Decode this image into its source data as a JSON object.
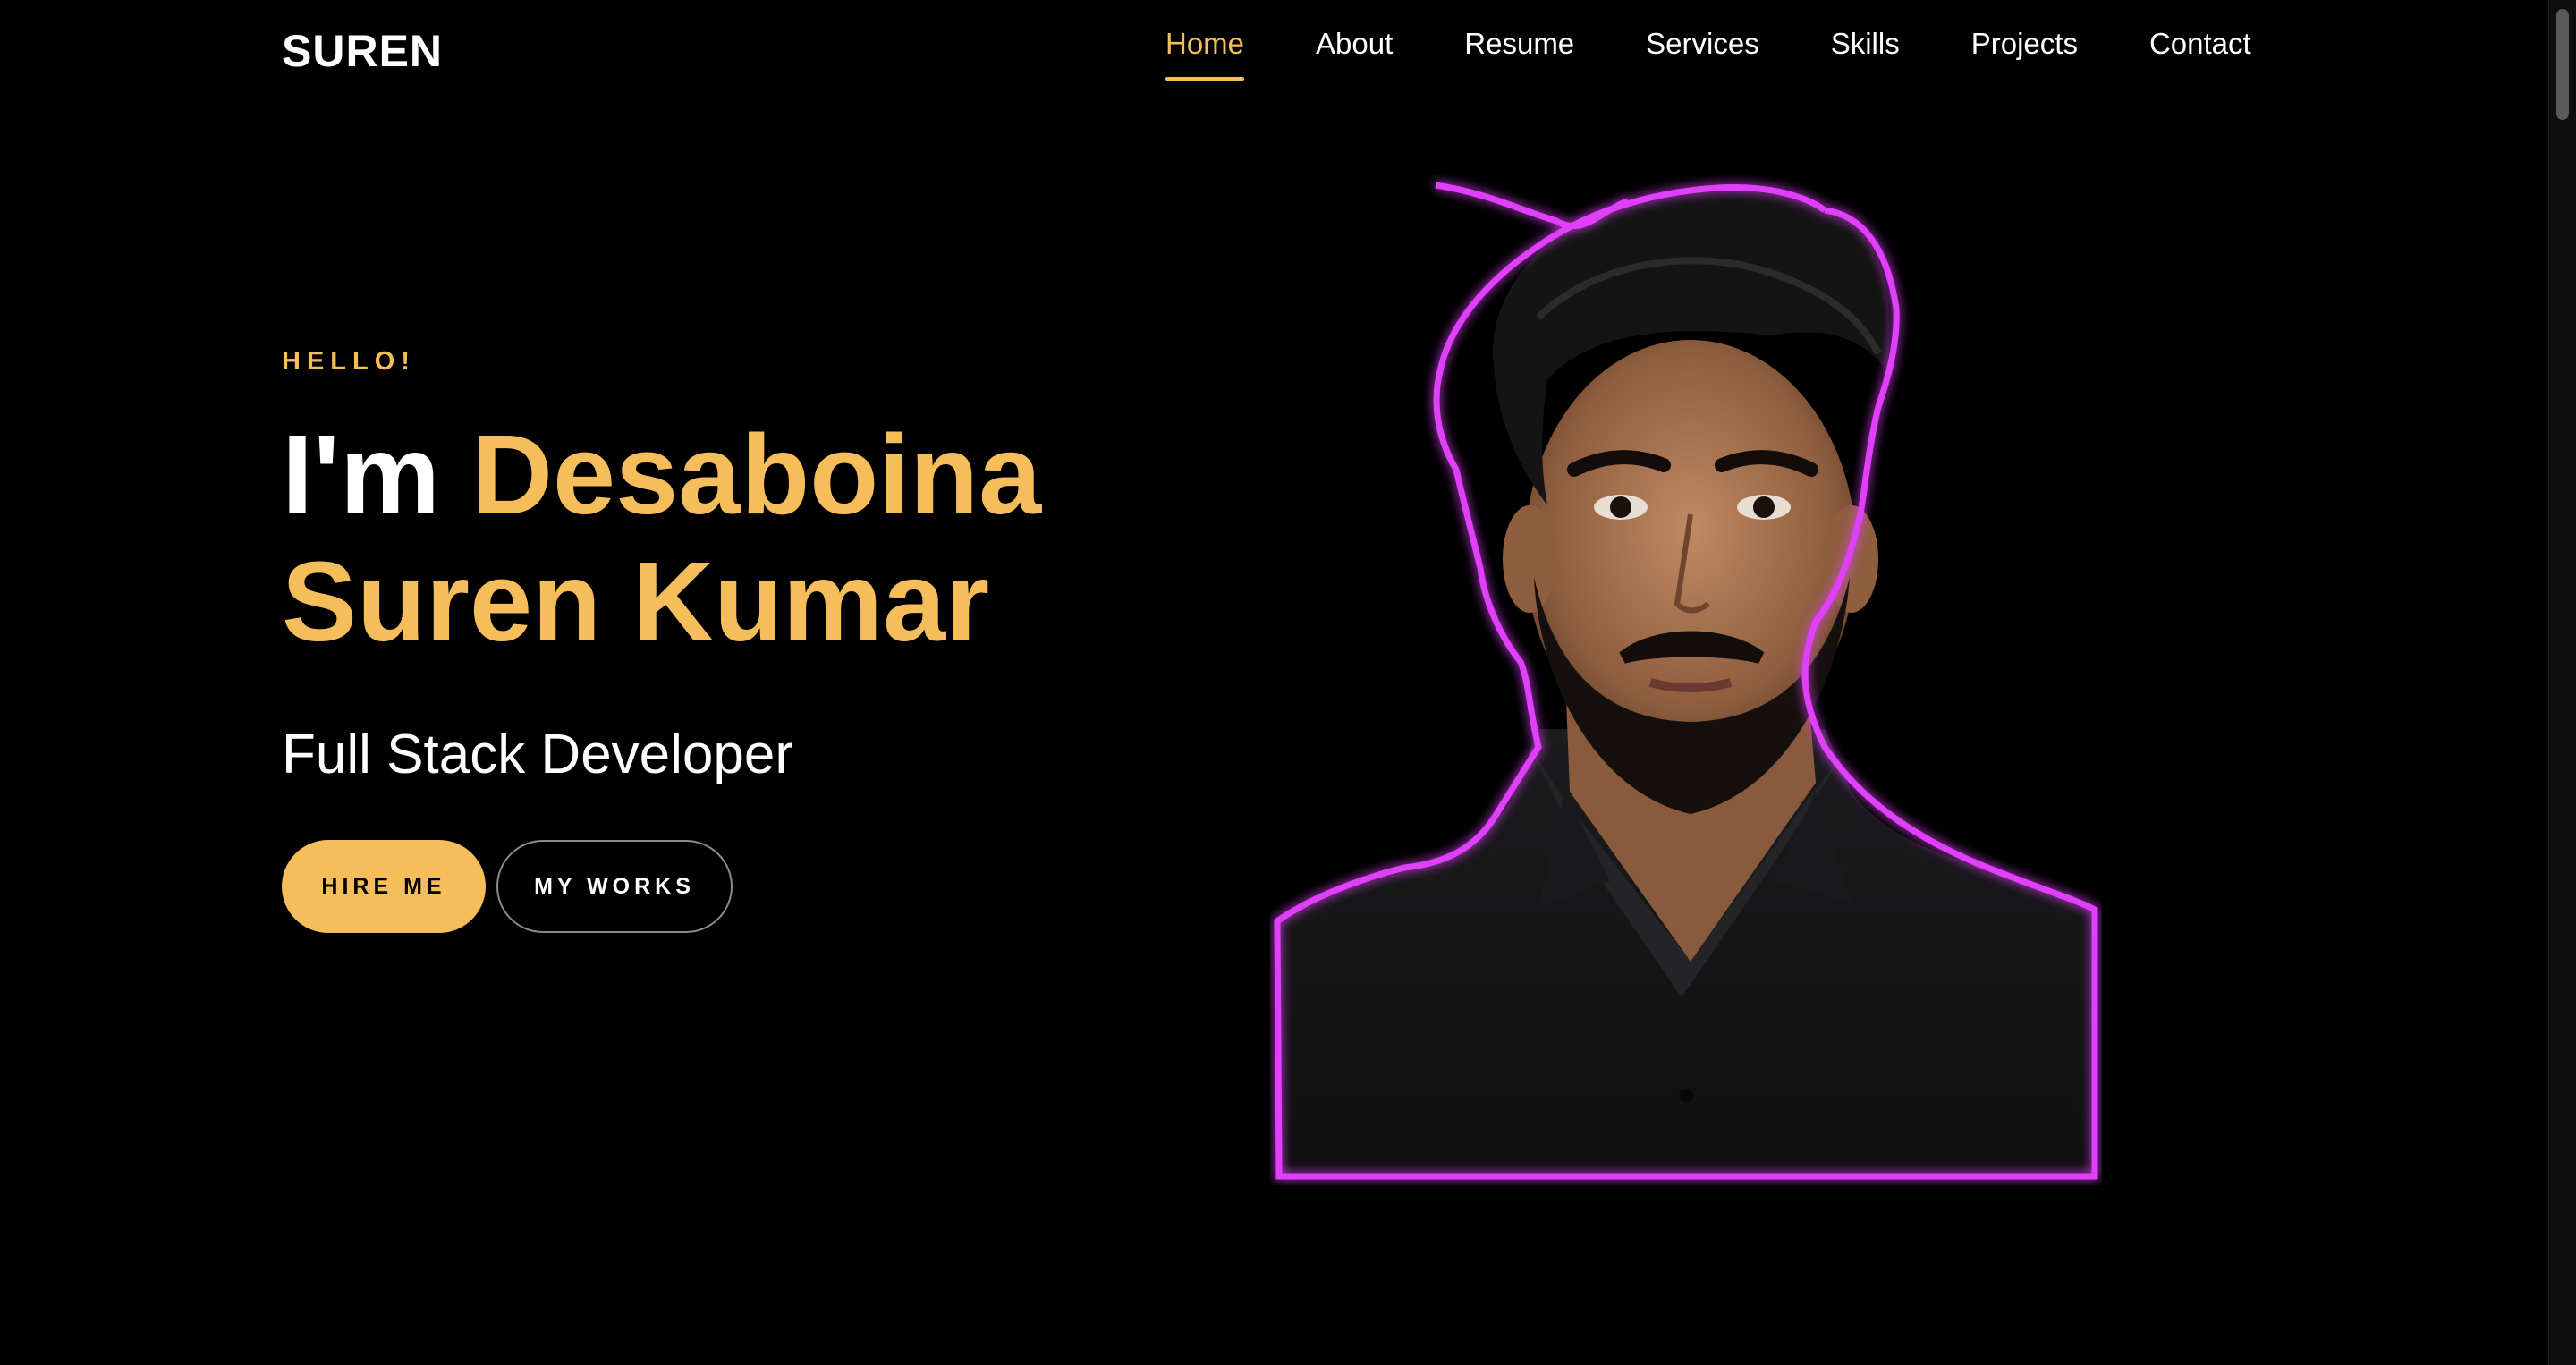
{
  "brand": {
    "name": "SUREN"
  },
  "nav": {
    "items": [
      {
        "label": "Home",
        "active": true
      },
      {
        "label": "About"
      },
      {
        "label": "Resume"
      },
      {
        "label": "Services"
      },
      {
        "label": "Skills"
      },
      {
        "label": "Projects"
      },
      {
        "label": "Contact"
      }
    ]
  },
  "hero": {
    "greeting": "HELLO!",
    "intro": "I'm ",
    "name_line1": "Desaboina",
    "name_line2": "Suren Kumar",
    "role": "Full Stack Developer",
    "hire_button": "HIRE ME",
    "works_button": "MY WORKS"
  },
  "colors": {
    "accent": "#f6bd5b",
    "background": "#000000",
    "portrait_outline": "#e040fb"
  },
  "icons": {
    "portrait": "profile-photo"
  }
}
